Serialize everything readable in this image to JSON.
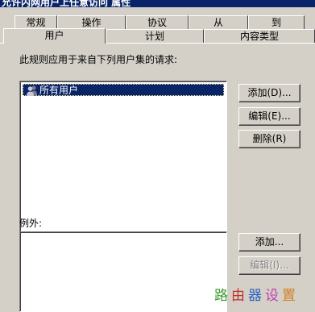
{
  "window": {
    "title": "允许内网用户上任意访问 属性"
  },
  "tabs": {
    "row1": [
      "常规",
      "操作",
      "协议",
      "从",
      "到"
    ],
    "row2": [
      "用户",
      "计划",
      "内容类型"
    ],
    "selected": "用户"
  },
  "users_section": {
    "label": "此规则应用于来自下列用户集的请求:",
    "items": [
      {
        "label": "所有用户",
        "icon": "users-icon",
        "selected": true
      }
    ]
  },
  "buttons": {
    "add": "添加(D)...",
    "edit": "编辑(E)...",
    "delete": "删除(R)",
    "add2": "添加...",
    "edit2": "编辑(I)..."
  },
  "exceptions_section": {
    "label": "例外:"
  },
  "watermark": {
    "chars": [
      "路",
      "由",
      "器",
      "设",
      "置"
    ],
    "colors": [
      "#3a9a2a",
      "#c03030",
      "#2a5fc0",
      "#c040b0",
      "#d08020"
    ]
  }
}
